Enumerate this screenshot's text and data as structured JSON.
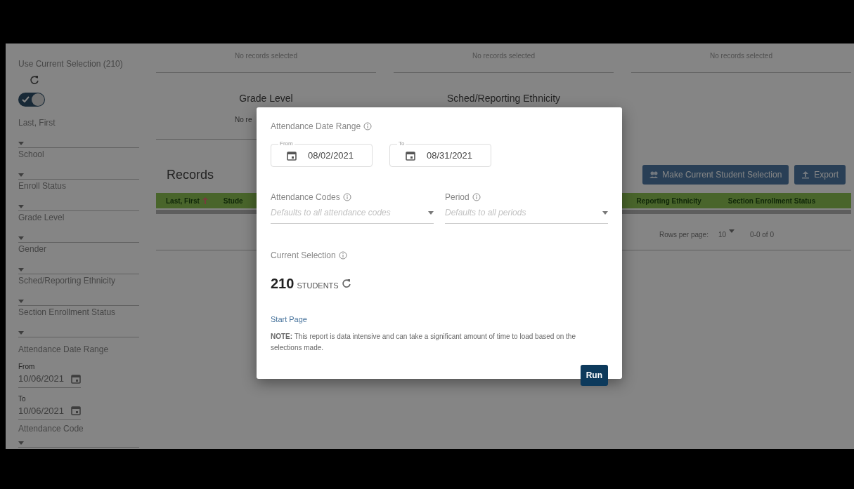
{
  "sidebar": {
    "use_selection": {
      "label": "Use Current Selection (210)",
      "on": true
    },
    "filters": [
      {
        "label": "Last, First"
      },
      {
        "label": "School"
      },
      {
        "label": "Enroll Status"
      },
      {
        "label": "Grade Level"
      },
      {
        "label": "Gender"
      },
      {
        "label": "Sched/Reporting Ethnicity"
      },
      {
        "label": "Section Enrollment Status"
      }
    ],
    "date_range": {
      "label": "Attendance Date Range",
      "from_label": "From",
      "from": "10/06/2021",
      "to_label": "To",
      "to": "10/06/2021"
    },
    "attendance_code": {
      "label": "Attendance Code"
    }
  },
  "summary": {
    "panels": [
      {
        "text": "No records selected"
      },
      {
        "text": "No records selected"
      },
      {
        "text": "No records selected"
      }
    ],
    "groups": [
      {
        "title": "Grade Level",
        "text": "No re"
      },
      {
        "title": "Sched/Reporting Ethnicity"
      }
    ]
  },
  "records": {
    "title": "Records",
    "buttons": [
      {
        "label": "Make Current Student Selection"
      },
      {
        "label": "Export"
      }
    ],
    "columns": [
      {
        "label": "Last, First",
        "sorted": true
      },
      {
        "label": "Stude",
        "sorted": false
      },
      {
        "label": "Reporting Ethnicity",
        "sorted": false
      },
      {
        "label": "Section Enrollment Status",
        "sorted": false
      }
    ],
    "rows_per_page_label": "Rows per page:",
    "rows_per_page": "10",
    "range": "0-0 of 0"
  },
  "dialog": {
    "date_range_label": "Attendance Date Range",
    "from_label": "From",
    "from": "08/02/2021",
    "to_label": "To",
    "to": "08/31/2021",
    "selects": [
      {
        "label": "Attendance Codes",
        "placeholder": "Defaults to all attendance codes"
      },
      {
        "label": "Period",
        "placeholder": "Defaults to all periods"
      }
    ],
    "current_selection_label": "Current Selection",
    "count": "210",
    "count_unit": "STUDENTS",
    "link": "Start Page",
    "note": "**NOTE:** This report is data intensive and can take a significant amount of time to load based on the selections made.",
    "run_button": "Run"
  }
}
